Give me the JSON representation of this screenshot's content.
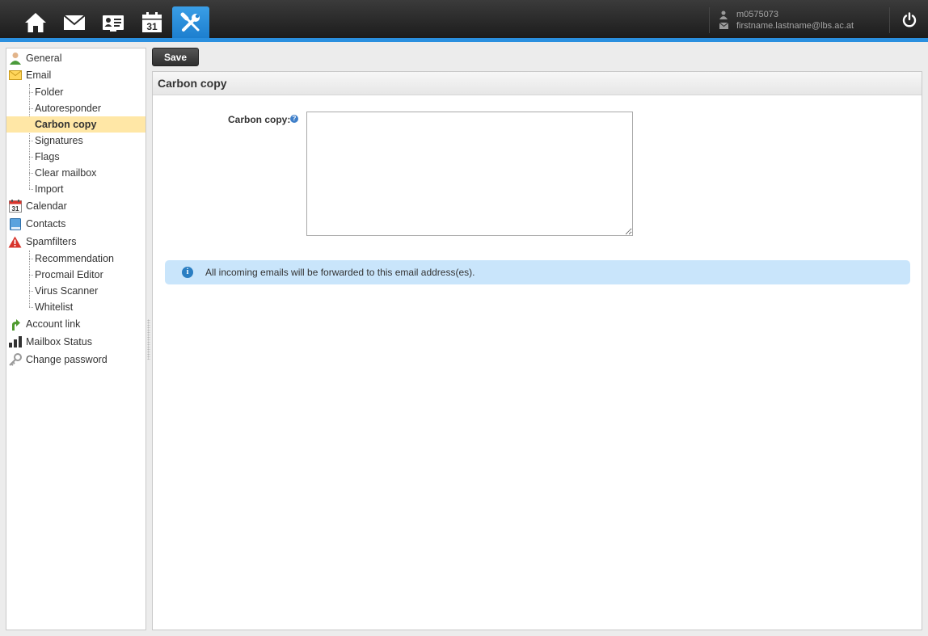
{
  "nav": {
    "items": [
      {
        "icon": "home-icon"
      },
      {
        "icon": "mail-icon"
      },
      {
        "icon": "contacts-card-icon"
      },
      {
        "icon": "calendar-icon",
        "text": "31"
      },
      {
        "icon": "settings-tools-icon",
        "active": true
      }
    ],
    "active_color": "#2a8fdf"
  },
  "user": {
    "username": "m0575073",
    "email": "firstname.lastname@lbs.ac.at"
  },
  "sidebar": {
    "general": "General",
    "email": "Email",
    "email_children": [
      "Folder",
      "Autoresponder",
      "Carbon copy",
      "Signatures",
      "Flags",
      "Clear mailbox",
      "Import"
    ],
    "calendar": "Calendar",
    "calendar_icon_text": "31",
    "contacts": "Contacts",
    "spamfilters": "Spamfilters",
    "spam_children": [
      "Recommendation",
      "Procmail Editor",
      "Virus Scanner",
      "Whitelist"
    ],
    "account_link": "Account link",
    "mailbox_status": "Mailbox Status",
    "change_password": "Change password",
    "selected": "Carbon copy",
    "selected_color": "#ffe7a6"
  },
  "toolbar": {
    "save_label": "Save"
  },
  "panel": {
    "title": "Carbon copy",
    "field_label": "Carbon copy:",
    "help_glyph": "?",
    "textarea_value": "",
    "info_glyph": "i",
    "info_text": "All incoming emails will be forwarded to this email address(es)."
  }
}
